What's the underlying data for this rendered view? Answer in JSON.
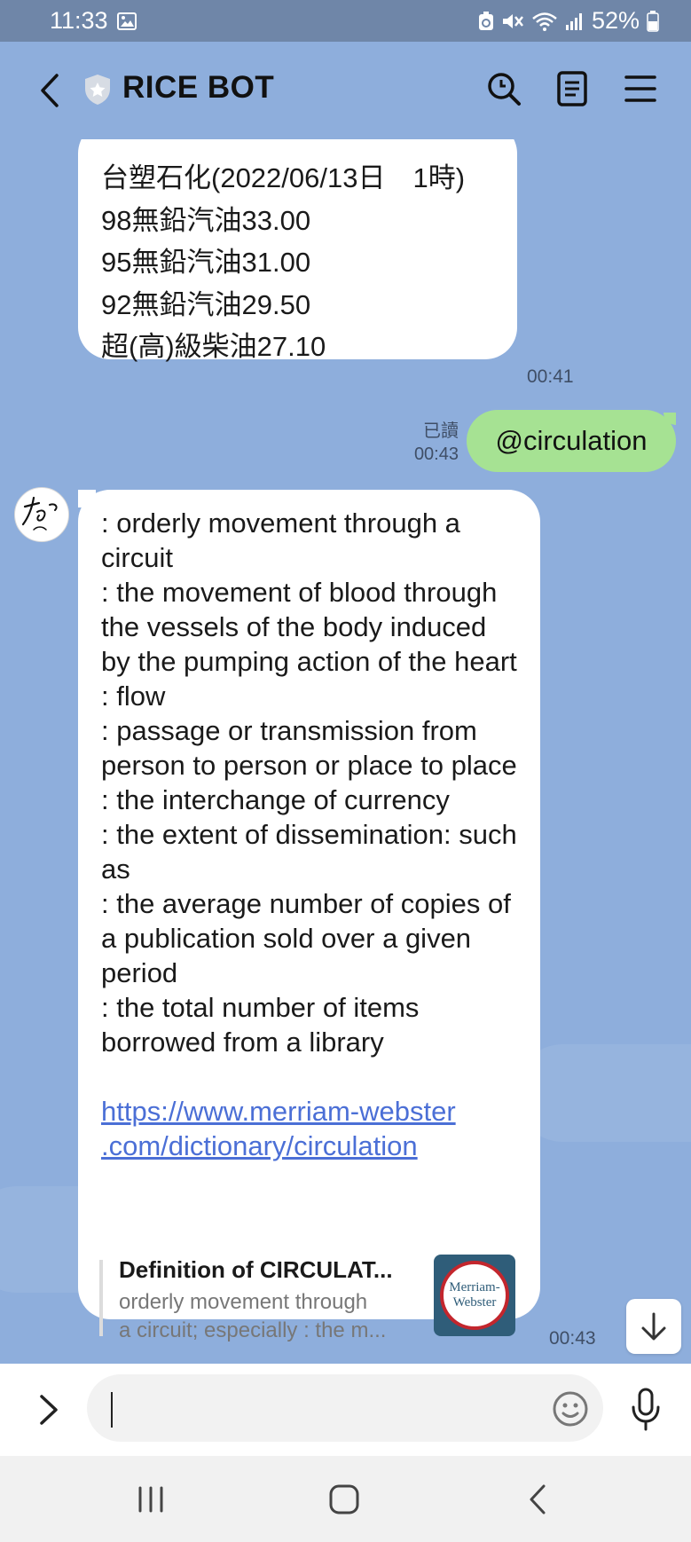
{
  "status_bar": {
    "time": "11:33",
    "battery": "52%"
  },
  "header": {
    "title": "RICE BOT"
  },
  "messages": {
    "fuel": {
      "lines": [
        "台塑石化(2022/06/13日　1時)",
        "98無鉛汽油33.00",
        "95無鉛汽油31.00",
        "92無鉛汽油29.50",
        "超(高)級柴油27.10"
      ],
      "time": "00:41"
    },
    "sent": {
      "text": "@circulation",
      "read_label": "已讀",
      "time": "00:43"
    },
    "definition": {
      "text": ": orderly movement through a circuit\n: the movement of blood through the vessels of the body induced by the pumping action of the heart\n: flow\n: passage or transmission from person to person or place to place\n: the interchange of currency\n: the extent of dissemination: such as\n: the average number of copies of a publication sold over a given period\n: the total number of items borrowed from a library",
      "link": "https://www.merriam-webster\n.com/dictionary/circulation",
      "preview_title": "Definition of CIRCULAT...",
      "preview_desc_1": "orderly movement through",
      "preview_desc_2": "a circuit; especially : the m...",
      "logo_text_1": "Merriam-",
      "logo_text_2": "Webster",
      "time": "00:43"
    }
  },
  "input": {
    "placeholder": ""
  },
  "colors": {
    "chat_background": "#8eaedc",
    "outgoing_bubble": "#a6e293",
    "link": "#4b6fd6"
  },
  "icons": {
    "back": "chevron-left-icon",
    "search": "search-icon",
    "notes": "notes-icon",
    "menu": "hamburger-menu-icon",
    "scroll_down": "arrow-down-icon",
    "expand": "chevron-right-icon",
    "emoji": "emoji-icon",
    "mic": "microphone-icon"
  }
}
